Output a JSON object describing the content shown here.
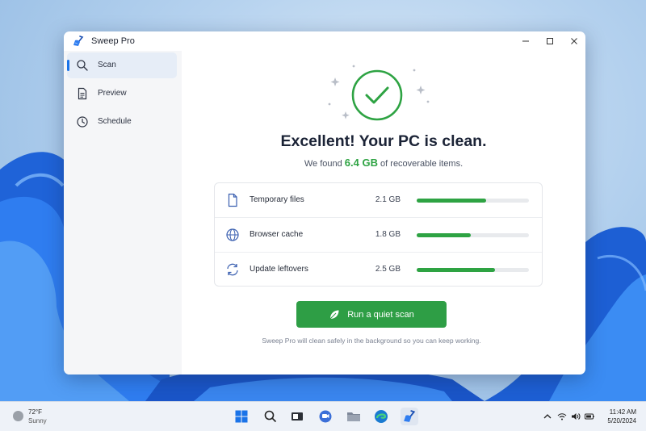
{
  "window": {
    "title": "Sweep Pro"
  },
  "sidebar": {
    "items": [
      {
        "label": "Scan",
        "icon": "search-icon",
        "active": true
      },
      {
        "label": "Preview",
        "icon": "document-icon",
        "active": false
      },
      {
        "label": "Schedule",
        "icon": "clock-icon",
        "active": false
      }
    ]
  },
  "main": {
    "headline": "Excellent! Your PC is clean.",
    "found_prefix": "We found",
    "found_amount": "6.4 GB",
    "found_suffix": "of recoverable items.",
    "results": [
      {
        "label": "Temporary files",
        "size": "2.1 GB",
        "icon": "file-icon",
        "fill": 0.62
      },
      {
        "label": "Browser cache",
        "size": "1.8 GB",
        "icon": "globe-icon",
        "fill": 0.48
      },
      {
        "label": "Update leftovers",
        "size": "2.5 GB",
        "icon": "refresh-icon",
        "fill": 0.7
      }
    ],
    "scan_button": "Run a quiet scan",
    "note": "Sweep Pro will clean safely in the background so you can keep working."
  },
  "taskbar": {
    "weather_temp": "72°F",
    "weather_condition": "Sunny",
    "time": "11:42 AM",
    "date": "5/20/2024"
  },
  "colors": {
    "accent": "#2ea343",
    "nav_accent": "#1a73e8"
  }
}
